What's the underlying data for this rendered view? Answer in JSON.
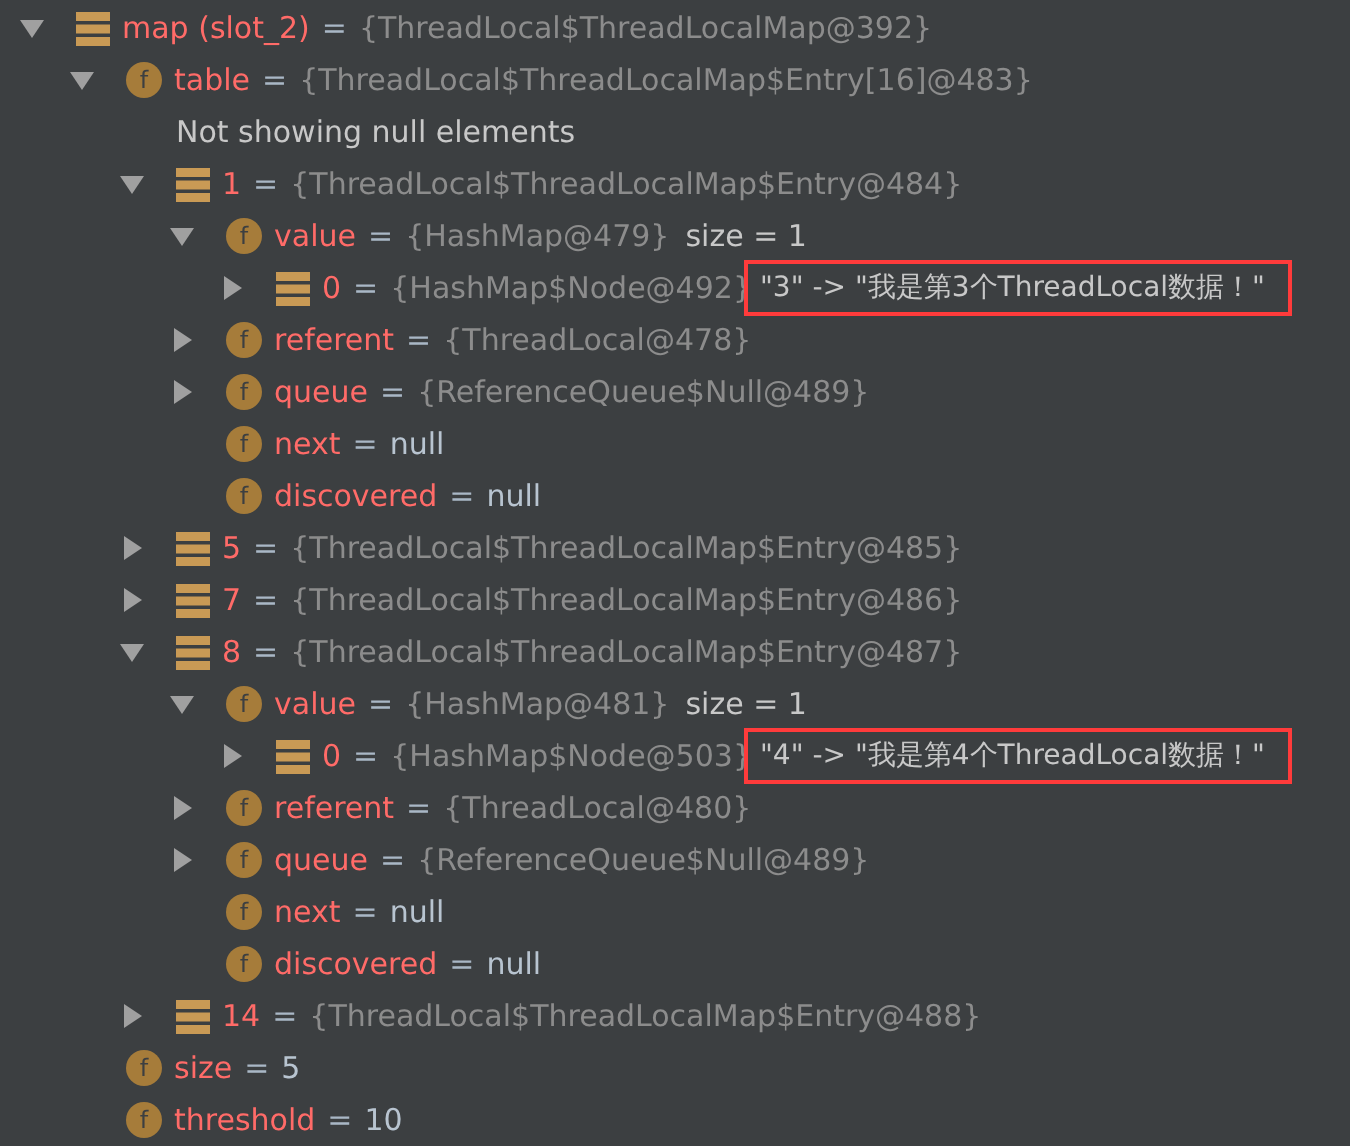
{
  "tree": [
    {
      "kind": "array",
      "name": "map (slot_2)",
      "eq": "=",
      "value": "{ThreadLocal$ThreadLocalMap@392}",
      "reference": true,
      "expanded": true,
      "children": [
        {
          "kind": "field",
          "glyph": "f",
          "name": "table",
          "eq": "=",
          "value": "{ThreadLocal$ThreadLocalMap$Entry[16]@483}",
          "reference": true,
          "expanded": true,
          "children": [
            {
              "kind": "note",
              "text": "Not showing null elements"
            },
            {
              "kind": "array",
              "name": "1",
              "eq": "=",
              "value": "{ThreadLocal$ThreadLocalMap$Entry@484}",
              "reference": true,
              "expanded": true,
              "children": [
                {
                  "kind": "field",
                  "glyph": "f",
                  "name": "value",
                  "eq": "=",
                  "value": "{HashMap@479}",
                  "reference": true,
                  "extra": "size = 1",
                  "expanded": true,
                  "children": [
                    {
                      "kind": "array",
                      "name": "0",
                      "eq": "=",
                      "value": "{HashMap$Node@492}",
                      "reference": true,
                      "highlight": "\"3\" -> \"我是第3个ThreadLocal数据！\"",
                      "expanded": false
                    }
                  ]
                },
                {
                  "kind": "field",
                  "glyph": "f",
                  "name": "referent",
                  "eq": "=",
                  "value": "{ThreadLocal@478}",
                  "reference": true,
                  "expanded": false
                },
                {
                  "kind": "field",
                  "glyph": "f",
                  "name": "queue",
                  "eq": "=",
                  "value": "{ReferenceQueue$Null@489}",
                  "reference": true,
                  "expanded": false
                },
                {
                  "kind": "field",
                  "glyph": "f",
                  "name": "next",
                  "eq": "=",
                  "value": "null",
                  "reference": false
                },
                {
                  "kind": "field",
                  "glyph": "f",
                  "name": "discovered",
                  "eq": "=",
                  "value": "null",
                  "reference": false
                }
              ]
            },
            {
              "kind": "array",
              "name": "5",
              "eq": "=",
              "value": "{ThreadLocal$ThreadLocalMap$Entry@485}",
              "reference": true,
              "expanded": false
            },
            {
              "kind": "array",
              "name": "7",
              "eq": "=",
              "value": "{ThreadLocal$ThreadLocalMap$Entry@486}",
              "reference": true,
              "expanded": false
            },
            {
              "kind": "array",
              "name": "8",
              "eq": "=",
              "value": "{ThreadLocal$ThreadLocalMap$Entry@487}",
              "reference": true,
              "expanded": true,
              "children": [
                {
                  "kind": "field",
                  "glyph": "f",
                  "name": "value",
                  "eq": "=",
                  "value": "{HashMap@481}",
                  "reference": true,
                  "extra": "size = 1",
                  "expanded": true,
                  "children": [
                    {
                      "kind": "array",
                      "name": "0",
                      "eq": "=",
                      "value": "{HashMap$Node@503}",
                      "reference": true,
                      "highlight": "\"4\" -> \"我是第4个ThreadLocal数据！\"",
                      "expanded": false
                    }
                  ]
                },
                {
                  "kind": "field",
                  "glyph": "f",
                  "name": "referent",
                  "eq": "=",
                  "value": "{ThreadLocal@480}",
                  "reference": true,
                  "expanded": false
                },
                {
                  "kind": "field",
                  "glyph": "f",
                  "name": "queue",
                  "eq": "=",
                  "value": "{ReferenceQueue$Null@489}",
                  "reference": true,
                  "expanded": false
                },
                {
                  "kind": "field",
                  "glyph": "f",
                  "name": "next",
                  "eq": "=",
                  "value": "null",
                  "reference": false
                },
                {
                  "kind": "field",
                  "glyph": "f",
                  "name": "discovered",
                  "eq": "=",
                  "value": "null",
                  "reference": false
                }
              ]
            },
            {
              "kind": "array",
              "name": "14",
              "eq": "=",
              "value": "{ThreadLocal$ThreadLocalMap$Entry@488}",
              "reference": true,
              "expanded": false
            }
          ]
        },
        {
          "kind": "field",
          "glyph": "f",
          "name": "size",
          "eq": "=",
          "value": "5",
          "reference": false
        },
        {
          "kind": "field",
          "glyph": "f",
          "name": "threshold",
          "eq": "=",
          "value": "10",
          "reference": false
        }
      ]
    }
  ]
}
